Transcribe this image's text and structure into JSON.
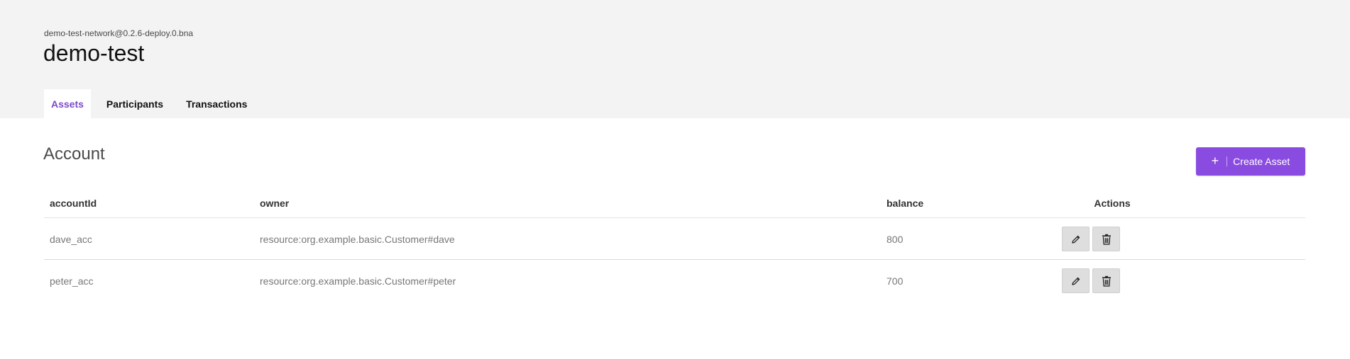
{
  "header": {
    "network_id": "demo-test-network@0.2.6-deploy.0.bna",
    "title": "demo-test"
  },
  "tabs": [
    {
      "label": "Assets",
      "active": true
    },
    {
      "label": "Participants",
      "active": false
    },
    {
      "label": "Transactions",
      "active": false
    }
  ],
  "main": {
    "section_title": "Account",
    "create_button": {
      "label": "Create Asset",
      "icon": "plus-icon"
    },
    "table": {
      "headers": [
        "accountId",
        "owner",
        "balance",
        "Actions"
      ],
      "rows": [
        {
          "accountId": "dave_acc",
          "owner": "resource:org.example.basic.Customer#dave",
          "balance": "800"
        },
        {
          "accountId": "peter_acc",
          "owner": "resource:org.example.basic.Customer#peter",
          "balance": "700"
        }
      ],
      "row_actions": [
        {
          "name": "edit",
          "icon": "pencil-icon"
        },
        {
          "name": "delete",
          "icon": "trash-icon"
        }
      ]
    }
  },
  "colors": {
    "accent": "#8a4be0",
    "active_tab_text": "#7d49c9",
    "header_bg": "#f3f3f3",
    "action_button_bg": "#dedede"
  }
}
